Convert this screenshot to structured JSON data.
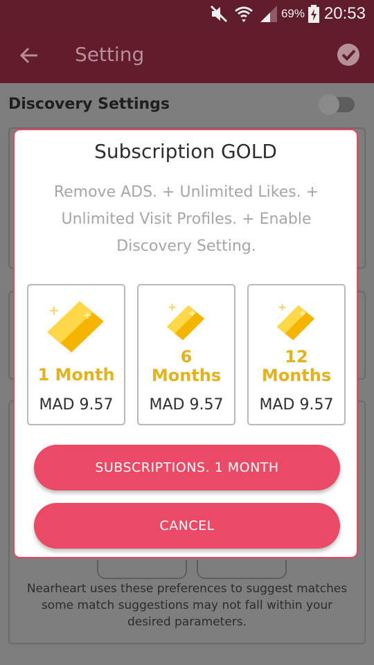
{
  "status_bar": {
    "battery_percent": "69%",
    "time": "20:53"
  },
  "toolbar": {
    "title": "Setting"
  },
  "page": {
    "discovery_label": "Discovery Settings",
    "footer_note": "Nearheart uses these preferences to suggest matches some match suggestions may not fall within your desired parameters."
  },
  "dialog": {
    "title": "Subscription GOLD",
    "description": "Remove ADS. + Unlimited Likes. + Unlimited Visit Profiles. + Enable Discovery Setting.",
    "plans": [
      {
        "duration": "1 Month",
        "price": "MAD 9.57"
      },
      {
        "duration": "6\nMonths",
        "price": "MAD 9.57"
      },
      {
        "duration": "12\nMonths",
        "price": "MAD 9.57"
      }
    ],
    "subscribe_label": "SUBSCRIPTIONS. 1 MONTH",
    "cancel_label": "CANCEL"
  },
  "colors": {
    "toolbar": "#631c2c",
    "accent": "#ea4a66",
    "gold_text": "#e3b221"
  }
}
